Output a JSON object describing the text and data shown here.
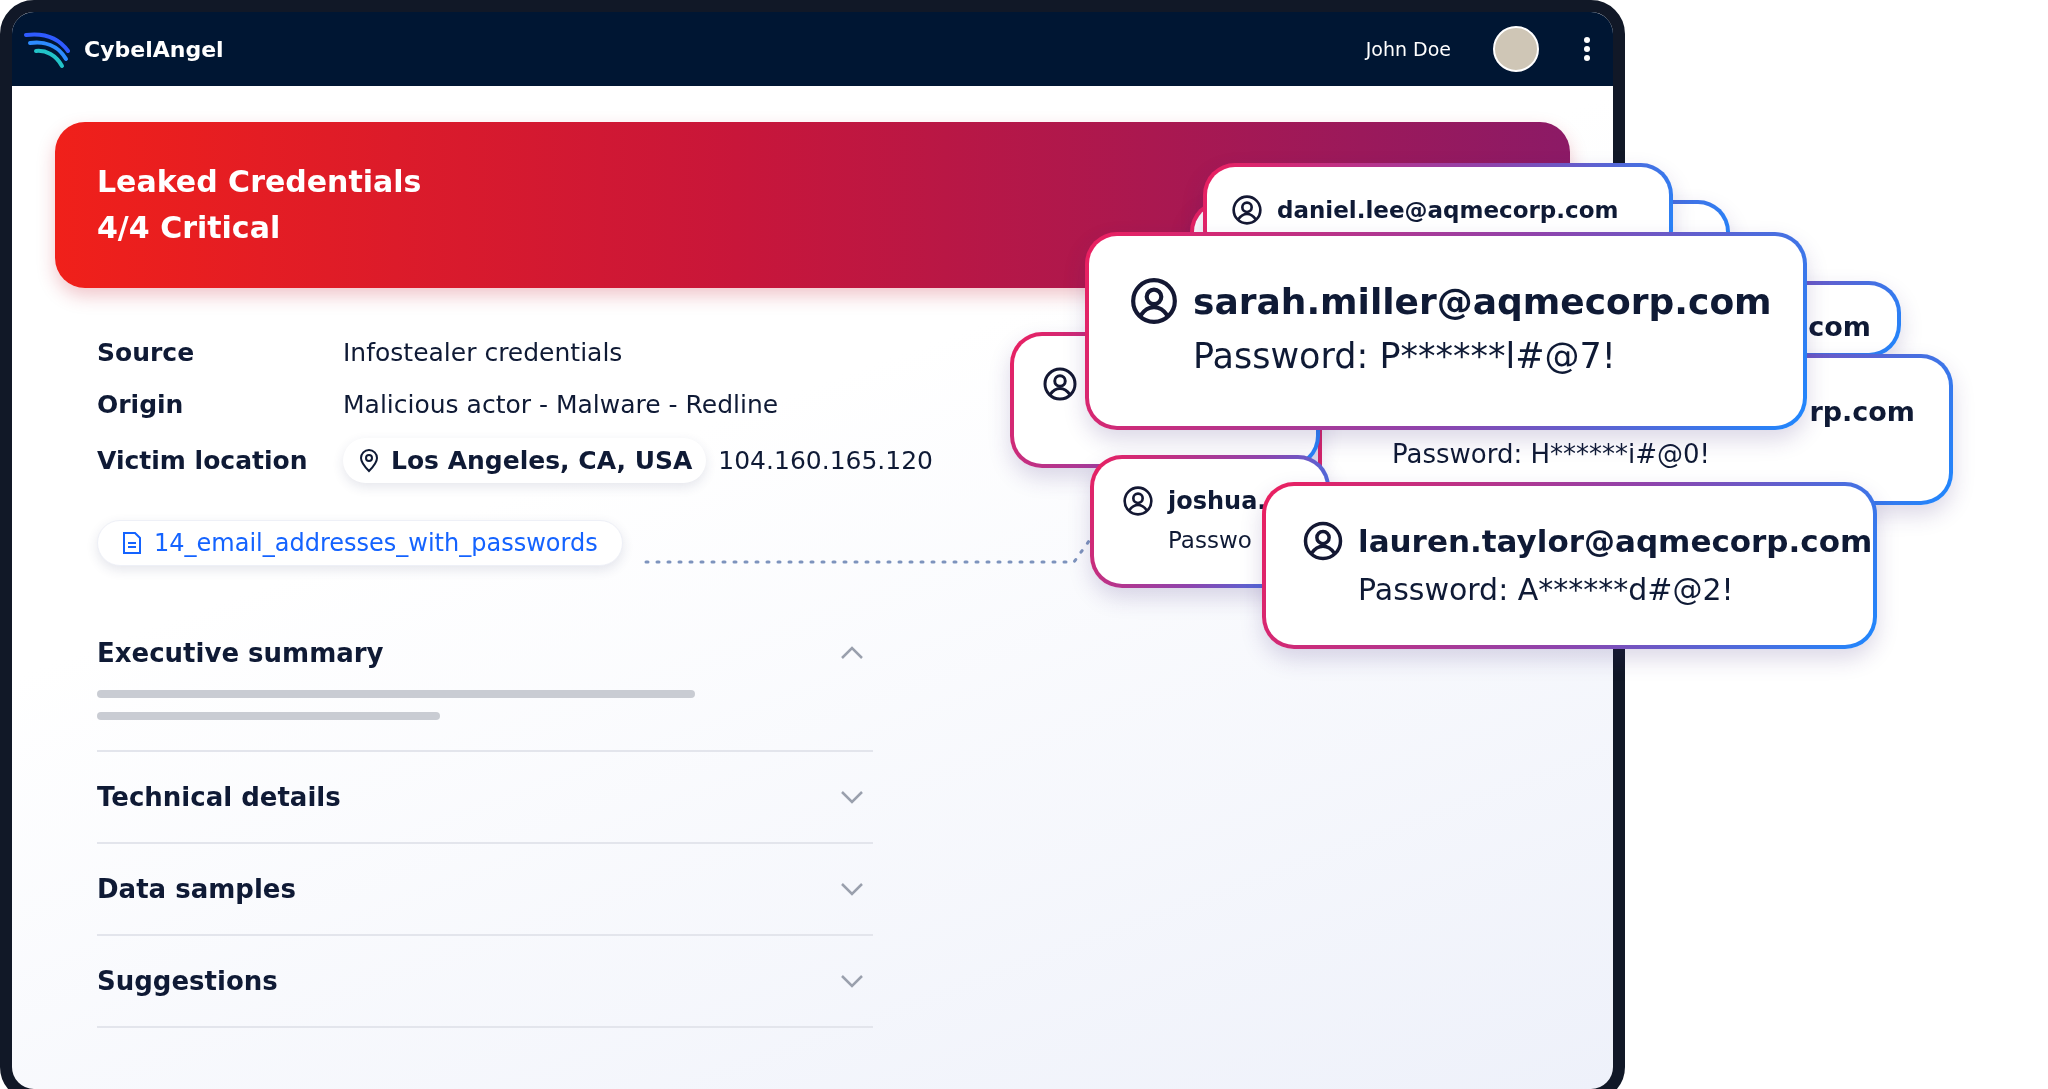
{
  "header": {
    "brand": "CybelAngel",
    "user": "John Doe"
  },
  "alert": {
    "title": "Leaked Credentials",
    "severity": "4/4 Critical"
  },
  "details": [
    {
      "kind": "text",
      "label": "Source",
      "value": "Infostealer credentials"
    },
    {
      "kind": "text",
      "label": "Origin",
      "value": "Malicious actor - Malware - Redline"
    },
    {
      "kind": "location",
      "label": "Victim location",
      "location": "Los Angeles, CA, USA",
      "value": "104.160.165.120"
    }
  ],
  "attachment": "14_email_addresses_with_passwords",
  "sections": [
    {
      "title": "Executive summary",
      "expanded": true
    },
    {
      "title": "Technical details",
      "expanded": false
    },
    {
      "title": "Data samples",
      "expanded": false
    },
    {
      "title": "Suggestions",
      "expanded": false
    }
  ],
  "credential_cards": [
    {
      "icon": true,
      "email": "daniel.lee@aqmecorp.com"
    },
    {
      "icon": false
    },
    {
      "icon": true,
      "email": "sarah.miller@aqmecorp.com",
      "password": "Password: P******l#@7!"
    },
    {
      "icon": false,
      "email": "com"
    },
    {
      "icon": true
    },
    {
      "icon": false,
      "email": "rp.com",
      "password": "Password: H******i#@0!"
    },
    {
      "icon": true,
      "email": "joshua.",
      "password": "Passwo"
    },
    {
      "icon": true,
      "email": "lauren.taylor@aqmecorp.com",
      "password": "Password: A******d#@2!"
    }
  ]
}
